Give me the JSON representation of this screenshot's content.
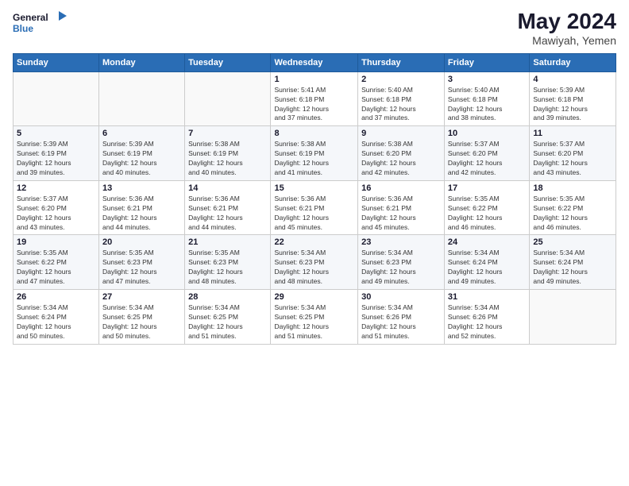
{
  "header": {
    "logo_line1": "General",
    "logo_line2": "Blue",
    "title": "May 2024",
    "subtitle": "Mawiyah, Yemen"
  },
  "weekdays": [
    "Sunday",
    "Monday",
    "Tuesday",
    "Wednesday",
    "Thursday",
    "Friday",
    "Saturday"
  ],
  "weeks": [
    [
      {
        "day": "",
        "info": ""
      },
      {
        "day": "",
        "info": ""
      },
      {
        "day": "",
        "info": ""
      },
      {
        "day": "1",
        "info": "Sunrise: 5:41 AM\nSunset: 6:18 PM\nDaylight: 12 hours\nand 37 minutes."
      },
      {
        "day": "2",
        "info": "Sunrise: 5:40 AM\nSunset: 6:18 PM\nDaylight: 12 hours\nand 37 minutes."
      },
      {
        "day": "3",
        "info": "Sunrise: 5:40 AM\nSunset: 6:18 PM\nDaylight: 12 hours\nand 38 minutes."
      },
      {
        "day": "4",
        "info": "Sunrise: 5:39 AM\nSunset: 6:18 PM\nDaylight: 12 hours\nand 39 minutes."
      }
    ],
    [
      {
        "day": "5",
        "info": "Sunrise: 5:39 AM\nSunset: 6:19 PM\nDaylight: 12 hours\nand 39 minutes."
      },
      {
        "day": "6",
        "info": "Sunrise: 5:39 AM\nSunset: 6:19 PM\nDaylight: 12 hours\nand 40 minutes."
      },
      {
        "day": "7",
        "info": "Sunrise: 5:38 AM\nSunset: 6:19 PM\nDaylight: 12 hours\nand 40 minutes."
      },
      {
        "day": "8",
        "info": "Sunrise: 5:38 AM\nSunset: 6:19 PM\nDaylight: 12 hours\nand 41 minutes."
      },
      {
        "day": "9",
        "info": "Sunrise: 5:38 AM\nSunset: 6:20 PM\nDaylight: 12 hours\nand 42 minutes."
      },
      {
        "day": "10",
        "info": "Sunrise: 5:37 AM\nSunset: 6:20 PM\nDaylight: 12 hours\nand 42 minutes."
      },
      {
        "day": "11",
        "info": "Sunrise: 5:37 AM\nSunset: 6:20 PM\nDaylight: 12 hours\nand 43 minutes."
      }
    ],
    [
      {
        "day": "12",
        "info": "Sunrise: 5:37 AM\nSunset: 6:20 PM\nDaylight: 12 hours\nand 43 minutes."
      },
      {
        "day": "13",
        "info": "Sunrise: 5:36 AM\nSunset: 6:21 PM\nDaylight: 12 hours\nand 44 minutes."
      },
      {
        "day": "14",
        "info": "Sunrise: 5:36 AM\nSunset: 6:21 PM\nDaylight: 12 hours\nand 44 minutes."
      },
      {
        "day": "15",
        "info": "Sunrise: 5:36 AM\nSunset: 6:21 PM\nDaylight: 12 hours\nand 45 minutes."
      },
      {
        "day": "16",
        "info": "Sunrise: 5:36 AM\nSunset: 6:21 PM\nDaylight: 12 hours\nand 45 minutes."
      },
      {
        "day": "17",
        "info": "Sunrise: 5:35 AM\nSunset: 6:22 PM\nDaylight: 12 hours\nand 46 minutes."
      },
      {
        "day": "18",
        "info": "Sunrise: 5:35 AM\nSunset: 6:22 PM\nDaylight: 12 hours\nand 46 minutes."
      }
    ],
    [
      {
        "day": "19",
        "info": "Sunrise: 5:35 AM\nSunset: 6:22 PM\nDaylight: 12 hours\nand 47 minutes."
      },
      {
        "day": "20",
        "info": "Sunrise: 5:35 AM\nSunset: 6:23 PM\nDaylight: 12 hours\nand 47 minutes."
      },
      {
        "day": "21",
        "info": "Sunrise: 5:35 AM\nSunset: 6:23 PM\nDaylight: 12 hours\nand 48 minutes."
      },
      {
        "day": "22",
        "info": "Sunrise: 5:34 AM\nSunset: 6:23 PM\nDaylight: 12 hours\nand 48 minutes."
      },
      {
        "day": "23",
        "info": "Sunrise: 5:34 AM\nSunset: 6:23 PM\nDaylight: 12 hours\nand 49 minutes."
      },
      {
        "day": "24",
        "info": "Sunrise: 5:34 AM\nSunset: 6:24 PM\nDaylight: 12 hours\nand 49 minutes."
      },
      {
        "day": "25",
        "info": "Sunrise: 5:34 AM\nSunset: 6:24 PM\nDaylight: 12 hours\nand 49 minutes."
      }
    ],
    [
      {
        "day": "26",
        "info": "Sunrise: 5:34 AM\nSunset: 6:24 PM\nDaylight: 12 hours\nand 50 minutes."
      },
      {
        "day": "27",
        "info": "Sunrise: 5:34 AM\nSunset: 6:25 PM\nDaylight: 12 hours\nand 50 minutes."
      },
      {
        "day": "28",
        "info": "Sunrise: 5:34 AM\nSunset: 6:25 PM\nDaylight: 12 hours\nand 51 minutes."
      },
      {
        "day": "29",
        "info": "Sunrise: 5:34 AM\nSunset: 6:25 PM\nDaylight: 12 hours\nand 51 minutes."
      },
      {
        "day": "30",
        "info": "Sunrise: 5:34 AM\nSunset: 6:26 PM\nDaylight: 12 hours\nand 51 minutes."
      },
      {
        "day": "31",
        "info": "Sunrise: 5:34 AM\nSunset: 6:26 PM\nDaylight: 12 hours\nand 52 minutes."
      },
      {
        "day": "",
        "info": ""
      }
    ]
  ]
}
